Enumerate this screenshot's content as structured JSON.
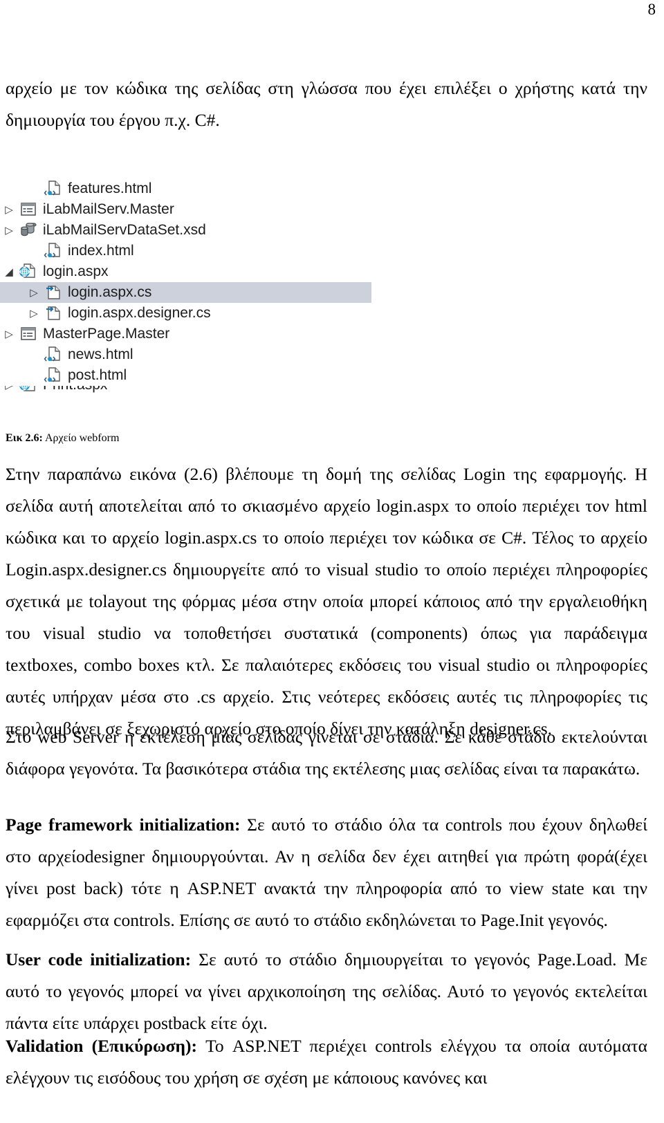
{
  "page": {
    "number": "8"
  },
  "paragraphs": {
    "intro": "αρχείο με τον κώδικα της σελίδας στη γλώσσα που έχει επιλέξει ο χρήστης κατά την δημιουργία του έργου π.χ.  C#.",
    "after_figure": "Στην παραπάνω εικόνα (2.6)  βλέπουμε τη δομή της σελίδας Login της εφαρμογής. Η σελίδα αυτή αποτελείται από το σκιασμένο αρχείο login.aspx το οποίο περιέχει τον html κώδικα και το αρχείο login.aspx.cs το οποίο περιέχει τον κώδικα σε C#. Τέλος το αρχείο Login.aspx.designer.cs δημιουργείτε από το visual studio το οποίο περιέχει πληροφορίες σχετικά με tolayout της φόρμας μέσα στην οποία μπορεί κάποιος από την εργαλειοθήκη του visual studio να τοποθετήσει συστατικά (components) όπως για παράδειγμα textboxes, combo boxes κτλ. Σε παλαιότερες εκδόσεις του visual studio οι πληροφορίες αυτές υπήρχαν μέσα στο .cs αρχείο. Στις νεότερες εκδόσεις αυτές τις πληροφορίες τις περιλαμβάνει σε ξεχωριστό αρχείο στο οποίο δίνει την κατάληξη designer.cs.",
    "stages_intro": "Στο web Server η εκτέλεση μίας σελίδας γίνεται σε στάδια. Σε κάθε στάδιο εκτελούνται διάφορα γεγονότα. Τα βασικότερα στάδια της εκτέλεσης μιας σελίδας είναι τα παρακάτω.",
    "stage1_label": "Page framework initialization:",
    "stage1_text": " Σε αυτό το στάδιο όλα τα controls που έχουν δηλωθεί στο αρχείοdesigner δημιουργούνται. Αν η σελίδα δεν έχει αιτηθεί για πρώτη φορά(έχει γίνει post back) τότε η ASP.NET ανακτά την πληροφορία από το view state και την εφαρμόζει στα controls. Επίσης σε αυτό το στάδιο εκδηλώνεται το Page.Init γεγονός.",
    "stage2_label": "User code initialization:",
    "stage2_text": " Σε αυτό το στάδιο δημιουργείται το γεγονός Page.Load. Με αυτό το γεγονός μπορεί να γίνει αρχικοποίηση της σελίδας. Αυτό το γεγονός εκτελείται πάντα είτε υπάρχει postback είτε όχι.",
    "stage3_label": "Validation (Επικύρωση):",
    "stage3_text": " Το ASP.NET περιέχει controls ελέγχου τα οποία αυτόματα ελέγχουν τις εισόδους του χρήση σε σχέση με κάποιους κανόνες και"
  },
  "figure": {
    "caption_label": "Εικ 2.6:",
    "caption_text": " Αρχείο webform",
    "selection_color": "#ccd1dc",
    "tree": [
      {
        "name": "features.html",
        "icon": "html-file-icon",
        "indent": 1,
        "chevron": "none",
        "selected": false
      },
      {
        "name": "iLabMailServ.Master",
        "icon": "master-page-icon",
        "indent": 0,
        "chevron": "collapsed",
        "selected": false
      },
      {
        "name": "iLabMailServDataSet.xsd",
        "icon": "dataset-icon",
        "indent": 0,
        "chevron": "collapsed",
        "selected": false
      },
      {
        "name": "index.html",
        "icon": "html-file-icon",
        "indent": 1,
        "chevron": "none",
        "selected": false
      },
      {
        "name": "login.aspx",
        "icon": "aspx-web-form-icon",
        "indent": 0,
        "chevron": "expanded",
        "selected": false
      },
      {
        "name": "login.aspx.cs",
        "icon": "csharp-file-icon",
        "indent": 1,
        "chevron": "collapsed",
        "selected": true
      },
      {
        "name": "login.aspx.designer.cs",
        "icon": "csharp-file-icon",
        "indent": 1,
        "chevron": "collapsed",
        "selected": false
      },
      {
        "name": "MasterPage.Master",
        "icon": "master-page-icon",
        "indent": 0,
        "chevron": "collapsed",
        "selected": false
      },
      {
        "name": "news.html",
        "icon": "html-file-icon",
        "indent": 1,
        "chevron": "none",
        "selected": false
      },
      {
        "name": "post.html",
        "icon": "html-file-icon",
        "indent": 1,
        "chevron": "none",
        "selected": false
      },
      {
        "name": "Print.aspx",
        "icon": "aspx-web-form-icon",
        "indent": 0,
        "chevron": "collapsed",
        "selected": false
      }
    ],
    "chevron_glyphs": {
      "collapsed": "▷",
      "expanded": "◢",
      "none": ""
    }
  }
}
